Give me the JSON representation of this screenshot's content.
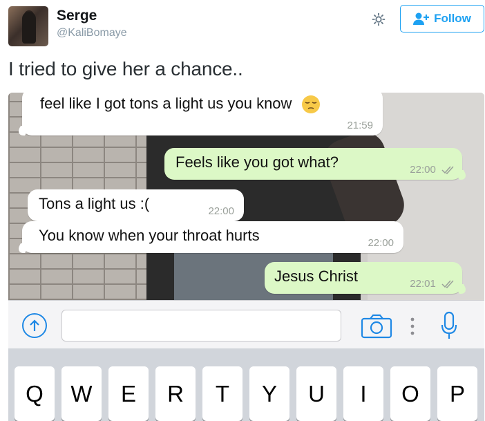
{
  "tweet": {
    "author_name": "Serge",
    "author_handle": "@KaliBomaye",
    "follow_label": "Follow",
    "text": "I tried to give her a chance.."
  },
  "chat": {
    "messages": [
      {
        "direction": "incoming",
        "text": "feel like I got tons a light us you know",
        "emoji": "pensive-face",
        "time": "21:59"
      },
      {
        "direction": "outgoing",
        "text": "Feels like you got what?",
        "time": "22:00"
      },
      {
        "direction": "incoming",
        "text": "Tons a light us :(",
        "time": "22:00"
      },
      {
        "direction": "incoming",
        "text": "You know when your throat hurts",
        "time": "22:00"
      },
      {
        "direction": "outgoing",
        "text": "Jesus Christ",
        "time": "22:01"
      }
    ]
  },
  "input_bar": {
    "upload_icon": "upload-arrow-icon",
    "camera_icon": "camera-icon",
    "more_icon": "vertical-dots-icon",
    "mic_icon": "microphone-icon",
    "message_value": ""
  },
  "keyboard": {
    "keys": [
      "Q",
      "W",
      "E",
      "R",
      "T",
      "Y",
      "U",
      "I",
      "O",
      "P"
    ]
  },
  "colors": {
    "follow_blue": "#1da1f2",
    "incoming_bubble": "#ffffff",
    "outgoing_bubble": "#dcf8c6",
    "keyboard_bg": "#d1d5db",
    "whatsapp_blue": "#1e88e5"
  }
}
